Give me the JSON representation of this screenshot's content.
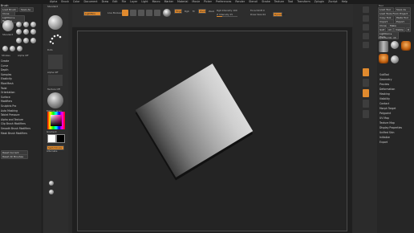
{
  "menubar": {
    "items": [
      "Alpha",
      "Brush",
      "Color",
      "Document",
      "Draw",
      "Edit",
      "File",
      "Layer",
      "Light",
      "Macro",
      "Marker",
      "Material",
      "Movie",
      "Picker",
      "Preferences",
      "Render",
      "Stencil",
      "Stroke",
      "Texture",
      "Tool",
      "Transform",
      "Zplugin",
      "Zscript",
      "Help"
    ]
  },
  "left_panel": {
    "title": "Brush",
    "load_brush": "Load Brush",
    "save_as": "Save As",
    "clone": "Clone",
    "lightbox": "Lightbox ▸ Brushes",
    "brush_name": "Standard",
    "stroke_label": "Strokes",
    "alpha_label": "Alpha Off",
    "texture_label": "Texture Off",
    "menu_items": [
      "Create",
      "Curve",
      "Depth",
      "Samples",
      "Elasticity",
      "FiberMesh",
      "Twist",
      "Orientation",
      "Surface",
      "Modifiers",
      "Sculptris Pro",
      "Auto Masking",
      "Tablet Pressure",
      "Alpha and Texture",
      "Clip Brush Modifiers",
      "Smooth Brush Modifiers",
      "Mask Brush Modifiers"
    ],
    "reset_current": "Reset Current Brush",
    "reset_all": "Reset All Brushes"
  },
  "second_column": {
    "brush_label": "Standard",
    "stroke_label": "Dots",
    "alpha_label": "Alpha Off",
    "texture_label": "Texture Off",
    "material_label": "MatCap Gray",
    "gradient_label": "Gradient",
    "switch_label": "SwitchColor",
    "alternate_label": "Alternate"
  },
  "toolbar": {
    "edit_label": "Edit",
    "draw_label": "Draw",
    "move_label": "Move",
    "scale_label": "Scale",
    "rotate_label": "Rotate",
    "mrgb": "Mrgb",
    "rgb": "Rgb",
    "m": "M",
    "zadd": "Zadd",
    "zsub": "Zsub",
    "focal_shift_label": "Focal Shift 0",
    "draw_size_label": "Draw Size 64",
    "z_intensity_label": "Z Intensity 25",
    "rgb_intensity_label": "Rgb Intensity 100",
    "dynamic": "Dynamic",
    "lightbox": "LightBox",
    "live_boolean": "Live Boolean"
  },
  "right_panel": {
    "title": "Tool",
    "load_tool": "Load Tool",
    "save_as": "Save As",
    "load_tools_from_project": "Load Tools From Project",
    "copy_tool": "Copy Tool",
    "paste_tool": "Paste Tool",
    "import": "Import",
    "export": "Export",
    "clone": "Clone",
    "make_polymesh": "Make PolyMesh3D",
    "goz": "GoZ",
    "all": "All",
    "visible": "Visible",
    "r": "R",
    "lightbox_tools": "Lightbox ▸ Tools",
    "current_tool": "Cylinder3D. 48",
    "menu_items": [
      "SubTool",
      "Geometry",
      "Preview",
      "Deformation",
      "Masking",
      "Visibility",
      "Contact",
      "Morph Target",
      "Polypaint",
      "UV Map",
      "Texture Map",
      "Display Properties",
      "Unified Skin",
      "Initialize",
      "Export"
    ]
  },
  "colors": {
    "accent": "#e08a2e",
    "background": "#2a2a2a",
    "canvas": "#1f1f1f"
  }
}
